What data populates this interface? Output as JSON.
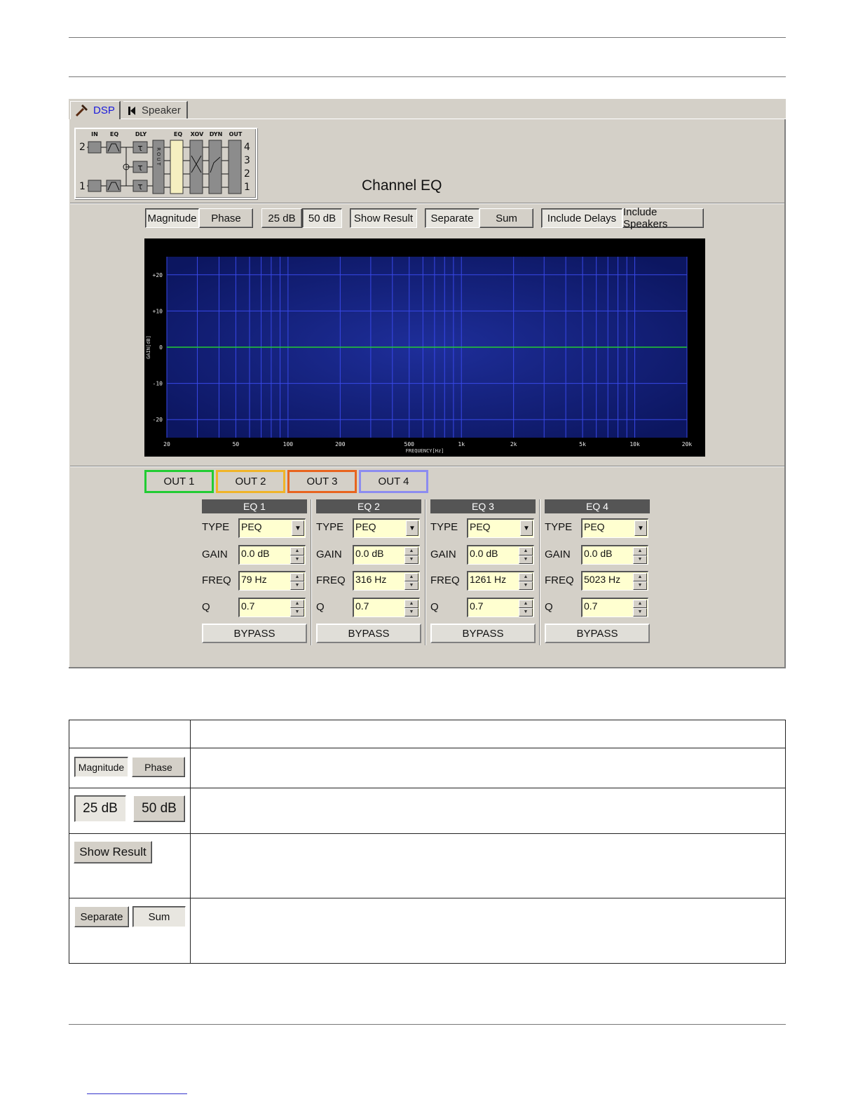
{
  "tabs": [
    {
      "label": "DSP",
      "icon": "hammer-icon",
      "active": true
    },
    {
      "label": "Speaker",
      "icon": "speaker-icon",
      "active": false
    }
  ],
  "routing": {
    "column_labels": [
      "IN",
      "EQ",
      "DLY",
      "EQ",
      "XOV",
      "DYN",
      "OUT"
    ],
    "inputs": [
      "2",
      "1"
    ],
    "outputs": [
      "4",
      "3",
      "2",
      "1"
    ],
    "router_label": "ROUT",
    "delay_symbol": "τ"
  },
  "title": "Channel EQ",
  "toolbar": {
    "magnitude": "Magnitude",
    "phase": "Phase",
    "db25": "25 dB",
    "db50": "50 dB",
    "show_result": "Show Result",
    "separate": "Separate",
    "sum": "Sum",
    "include_delays": "Include Delays",
    "include_speakers": "Include Speakers"
  },
  "chart_data": {
    "type": "line",
    "xlabel": "FREQUENCY[Hz]",
    "ylabel": "GAIN[dB]",
    "xscale": "log",
    "xlim": [
      20,
      20000
    ],
    "ylim": [
      -25,
      25
    ],
    "x_ticks": [
      "20",
      "50",
      "100",
      "200",
      "500",
      "1k",
      "2k",
      "5k",
      "10k",
      "20k"
    ],
    "y_ticks": [
      "+20",
      "+10",
      "0",
      "-10",
      "-20"
    ],
    "grid": true,
    "series": [
      {
        "x": [
          20,
          20000
        ],
        "y": [
          0,
          0
        ],
        "color": "#22cc33"
      }
    ]
  },
  "outputs": [
    {
      "label": "OUT 1",
      "color": "#22cc33"
    },
    {
      "label": "OUT 2",
      "color": "#f0b428"
    },
    {
      "label": "OUT 3",
      "color": "#e8641e"
    },
    {
      "label": "OUT 4",
      "color": "#8c8cf0"
    }
  ],
  "eq_labels": {
    "type": "TYPE",
    "gain": "GAIN",
    "freq": "FREQ",
    "q": "Q",
    "bypass": "BYPASS"
  },
  "eq": [
    {
      "title": "EQ 1",
      "type": "PEQ",
      "gain": "0.0 dB",
      "freq": "79 Hz",
      "q": "0.7"
    },
    {
      "title": "EQ 2",
      "type": "PEQ",
      "gain": "0.0 dB",
      "freq": "316 Hz",
      "q": "0.7"
    },
    {
      "title": "EQ 3",
      "type": "PEQ",
      "gain": "0.0 dB",
      "freq": "1261 Hz",
      "q": "0.7"
    },
    {
      "title": "EQ 4",
      "type": "PEQ",
      "gain": "0.0 dB",
      "freq": "5023 Hz",
      "q": "0.7"
    }
  ],
  "legend_table": {
    "rows": [
      {
        "buttons": [],
        "description": ""
      },
      {
        "buttons": [
          {
            "label": "Magnitude",
            "pressed": true
          },
          {
            "label": "Phase",
            "pressed": false
          }
        ],
        "description": ""
      },
      {
        "buttons": [
          {
            "label": "25 dB",
            "pressed": true
          },
          {
            "label": "50 dB",
            "pressed": false
          }
        ],
        "description": ""
      },
      {
        "buttons": [
          {
            "label": "Show Result",
            "pressed": false
          }
        ],
        "description": ""
      },
      {
        "buttons": [
          {
            "label": "Separate",
            "pressed": false
          },
          {
            "label": "Sum",
            "pressed": true
          }
        ],
        "description": ""
      }
    ]
  }
}
